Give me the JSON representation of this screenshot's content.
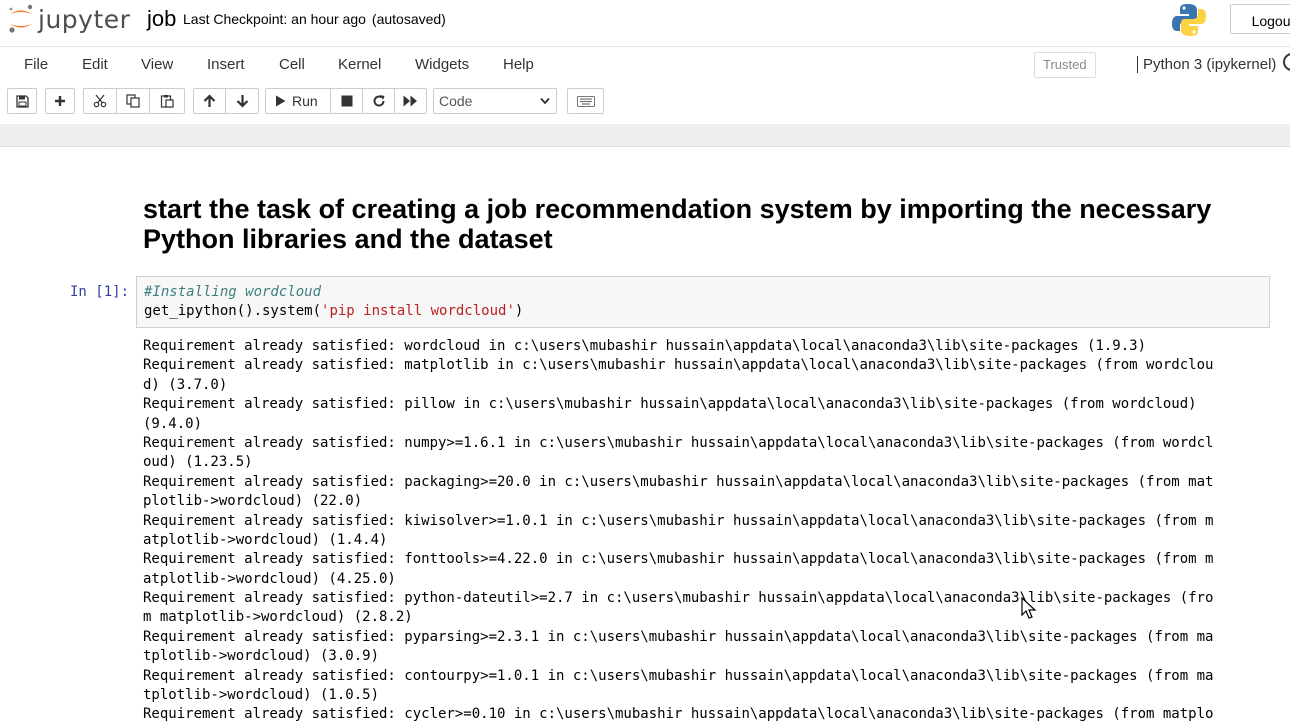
{
  "header": {
    "app_name": "jupyter",
    "notebook_name": "job",
    "checkpoint": "Last Checkpoint: an hour ago",
    "autosave": "(autosaved)",
    "logout_label": "Logout"
  },
  "menubar": {
    "items": [
      "File",
      "Edit",
      "View",
      "Insert",
      "Cell",
      "Kernel",
      "Widgets",
      "Help"
    ],
    "trusted": "Trusted",
    "kernel": "Python 3 (ipykernel)"
  },
  "toolbar": {
    "run_label": "Run",
    "cell_type": "Code"
  },
  "notebook": {
    "markdown_heading": "start the task of creating a job recommendation system by importing the necessary Python libraries and the dataset",
    "cell_prompt": "In [1]:",
    "code_comment": "#Installing wordcloud",
    "code_prefix": "get_ipython().system(",
    "code_string": "'pip install wordcloud'",
    "code_suffix": ")",
    "output_lines": [
      "Requirement already satisfied: wordcloud in c:\\users\\mubashir hussain\\appdata\\local\\anaconda3\\lib\\site-packages (1.9.3)",
      "Requirement already satisfied: matplotlib in c:\\users\\mubashir hussain\\appdata\\local\\anaconda3\\lib\\site-packages (from wordclou",
      "d) (3.7.0)",
      "Requirement already satisfied: pillow in c:\\users\\mubashir hussain\\appdata\\local\\anaconda3\\lib\\site-packages (from wordcloud)",
      "(9.4.0)",
      "Requirement already satisfied: numpy>=1.6.1 in c:\\users\\mubashir hussain\\appdata\\local\\anaconda3\\lib\\site-packages (from wordcl",
      "oud) (1.23.5)",
      "Requirement already satisfied: packaging>=20.0 in c:\\users\\mubashir hussain\\appdata\\local\\anaconda3\\lib\\site-packages (from mat",
      "plotlib->wordcloud) (22.0)",
      "Requirement already satisfied: kiwisolver>=1.0.1 in c:\\users\\mubashir hussain\\appdata\\local\\anaconda3\\lib\\site-packages (from m",
      "atplotlib->wordcloud) (1.4.4)",
      "Requirement already satisfied: fonttools>=4.22.0 in c:\\users\\mubashir hussain\\appdata\\local\\anaconda3\\lib\\site-packages (from m",
      "atplotlib->wordcloud) (4.25.0)",
      "Requirement already satisfied: python-dateutil>=2.7 in c:\\users\\mubashir hussain\\appdata\\local\\anaconda3\\lib\\site-packages (fro",
      "m matplotlib->wordcloud) (2.8.2)",
      "Requirement already satisfied: pyparsing>=2.3.1 in c:\\users\\mubashir hussain\\appdata\\local\\anaconda3\\lib\\site-packages (from ma",
      "tplotlib->wordcloud) (3.0.9)",
      "Requirement already satisfied: contourpy>=1.0.1 in c:\\users\\mubashir hussain\\appdata\\local\\anaconda3\\lib\\site-packages (from ma",
      "tplotlib->wordcloud) (1.0.5)",
      "Requirement already satisfied: cycler>=0.10 in c:\\users\\mubashir hussain\\appdata\\local\\anaconda3\\lib\\site-packages (from matplo"
    ]
  },
  "colors": {
    "jupyter_orange": "#f37726",
    "prompt_blue": "#303f9f",
    "comment": "#408080",
    "string": "#ba2121"
  }
}
